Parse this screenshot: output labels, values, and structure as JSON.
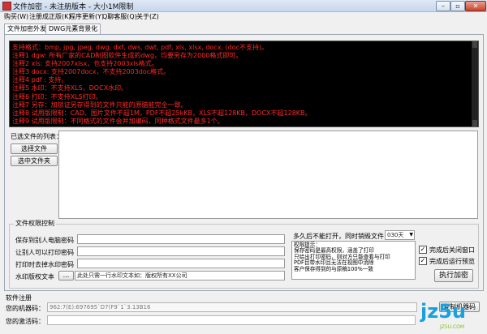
{
  "window": {
    "title": "文件加密 - 未注册版本 - 大小1M限制",
    "buttons": [
      "–",
      "▫",
      "✕"
    ]
  },
  "menu": [
    "购买(W)",
    "注册成正版(K)",
    "程序更新(Y)",
    "Q聊客服(Q)",
    "关于(Z)"
  ],
  "tabs": [
    "文件加密外发",
    "DWG元素背景化"
  ],
  "info_lines": [
    "支持格式：bmp, jpg, jpeg, dwg, dxf, dws, dwt, pdf, xls, xlsx, docx, (doc不支持)。",
    "注释1 dgw: 所有厂家的CAD制图软件生成的dwg，均要另存为2000格式即可。",
    "注释2 xls: 支持2007xlsx，也支持2003xls格式。",
    "注释3 docx: 支持2007docx，不支持2003doc格式。",
    "注释4 pdf : 支持。",
    "注释5 水印：不支持XLS，DOCX水印。",
    "注释6 打印：不支持XLS打印。",
    "注释7 另存：加锁证另存得到的文件只能的原脑能完全一致。",
    "注释8 试用版限制：CAD、图片文件不超1M，PDF不超25kKB，XLS不超128KB，DOCX不超128KB。",
    "注释9 试用版限制：不同格式的文件会并加编码，同种格式文件最多1个。"
  ],
  "file_list": {
    "label": "已选文件的列表：",
    "select_file": "选择文件",
    "select_folder": "选中文件夹"
  },
  "permissions": {
    "title": "文件权限控制",
    "row_labels": [
      "保存到别人电脑密码",
      "让别人可以打印密码",
      "打印时去掉水印密码",
      "水印版权文本"
    ],
    "browse": "...",
    "watermark_text": "此处只需一行水印文本如：版权所有XX公司",
    "expire_label": "多久后不能打开，同时销毁文件",
    "expire_value": "030天",
    "tips": [
      "权限提示：",
      "保存密码是最高权限，涵盖了打印",
      "只给出打印密码，则对方只能查看与打印",
      "PDF目带水印且无法在视图中消除",
      "客户保存得到的与原稿100%一致"
    ],
    "options": [
      {
        "label": "完成后关闭窗口",
        "checked": true
      },
      {
        "label": "完成后运行预览",
        "checked": true
      }
    ],
    "run_button": "执行加密"
  },
  "register": {
    "title": "软件注册",
    "machine_label": "您的机器码：",
    "machine_code": "962:7(E):697695`D7(F9`1`3.13B16",
    "activation_label": "您的激活码：",
    "activation_code": "",
    "copy_button": "复制机器码"
  },
  "watermark_logo": {
    "text": "jz5u",
    "sub": "JZ5U.COM",
    "colors": [
      "#1aa0dc",
      "#7dbb2a"
    ]
  },
  "colors": {
    "info_text": "#ff2a2a",
    "info_bg": "#000000"
  }
}
